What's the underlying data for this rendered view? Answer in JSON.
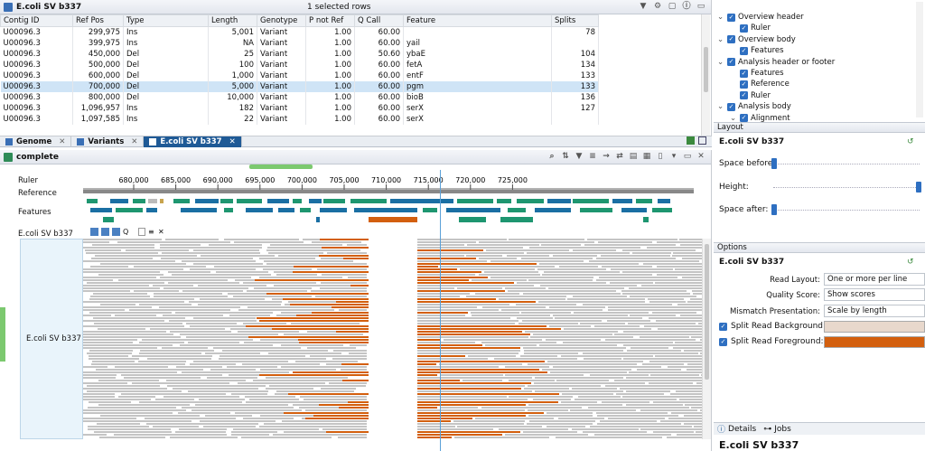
{
  "table": {
    "title": "E.coli SV b337",
    "selected": "1 selected rows",
    "columns": [
      "Contig ID",
      "Ref Pos",
      "Type",
      "Length",
      "Genotype",
      "P not Ref",
      "Q Call",
      "Feature",
      "Splits"
    ],
    "rows": [
      [
        "U00096.3",
        "299,975",
        "Ins",
        "5,001",
        "Variant",
        "1.00",
        "60.00",
        "",
        "78"
      ],
      [
        "U00096.3",
        "399,975",
        "Ins",
        "NA",
        "Variant",
        "1.00",
        "60.00",
        "yail",
        ""
      ],
      [
        "U00096.3",
        "450,000",
        "Del",
        "25",
        "Variant",
        "1.00",
        "50.60",
        "ybaE",
        "104"
      ],
      [
        "U00096.3",
        "500,000",
        "Del",
        "100",
        "Variant",
        "1.00",
        "60.00",
        "fetA",
        "134"
      ],
      [
        "U00096.3",
        "600,000",
        "Del",
        "1,000",
        "Variant",
        "1.00",
        "60.00",
        "entF",
        "133"
      ],
      [
        "U00096.3",
        "700,000",
        "Del",
        "5,000",
        "Variant",
        "1.00",
        "60.00",
        "pgm",
        "133"
      ],
      [
        "U00096.3",
        "800,000",
        "Del",
        "10,000",
        "Variant",
        "1.00",
        "60.00",
        "bioB",
        "136"
      ],
      [
        "U00096.3",
        "1,096,957",
        "Ins",
        "182",
        "Variant",
        "1.00",
        "60.00",
        "serX",
        "127"
      ],
      [
        "U00096.3",
        "1,097,585",
        "Ins",
        "22",
        "Variant",
        "1.00",
        "60.00",
        "serX",
        ""
      ]
    ],
    "selected_index": 5
  },
  "tabs": [
    {
      "label": "Genome",
      "active": false
    },
    {
      "label": "Variants",
      "active": false
    },
    {
      "label": "E.coli SV b337",
      "active": true
    }
  ],
  "view": {
    "title": "complete",
    "ruler_label": "Ruler",
    "reference_label": "Reference",
    "features_label": "Features",
    "track_title": "E.coli SV b337",
    "reads_label": "E.coli SV b337",
    "ticks": [
      "680,000",
      "685,000",
      "690,000",
      "695,000",
      "700,000",
      "705,000",
      "710,000",
      "715,000",
      "720,000",
      "725,000"
    ]
  },
  "right": {
    "tree": [
      {
        "label": "Overview header",
        "indent": 0,
        "expander": true
      },
      {
        "label": "Ruler",
        "indent": 1,
        "expander": false
      },
      {
        "label": "Overview body",
        "indent": 0,
        "expander": true
      },
      {
        "label": "Features",
        "indent": 1,
        "expander": false
      },
      {
        "label": "Analysis header or footer",
        "indent": 0,
        "expander": true
      },
      {
        "label": "Features",
        "indent": 1,
        "expander": false
      },
      {
        "label": "Reference",
        "indent": 1,
        "expander": false
      },
      {
        "label": "Ruler",
        "indent": 1,
        "expander": false
      },
      {
        "label": "Analysis body",
        "indent": 0,
        "expander": true
      },
      {
        "label": "Alignment",
        "indent": 1,
        "expander": true
      }
    ],
    "layout": {
      "title": "Layout",
      "subtitle": "E.coli SV b337",
      "space_before": "Space before:",
      "height": "Height:",
      "space_after": "Space after:"
    },
    "options": {
      "title": "Options",
      "subtitle": "E.coli SV b337",
      "read_layout_label": "Read Layout:",
      "read_layout_value": "One or more per line",
      "quality_label": "Quality Score:",
      "quality_value": "Show scores",
      "mismatch_label": "Mismatch Presentation:",
      "mismatch_value": "Scale by length",
      "split_bg_label": "Split Read Background:",
      "split_fg_label": "Split Read Foreground:",
      "split_bg_color": "#e8d8cc",
      "split_fg_color": "#d35f0e"
    },
    "details": {
      "tab_details": "Details",
      "tab_jobs": "Jobs",
      "title": "E.coli SV b337"
    }
  },
  "colors": {
    "read_gray": "#c4c4c4",
    "read_orange": "#d35f0e",
    "feature_green": "#1e9670",
    "feature_blue": "#1a6fa3",
    "accent": "#1f5a96"
  }
}
